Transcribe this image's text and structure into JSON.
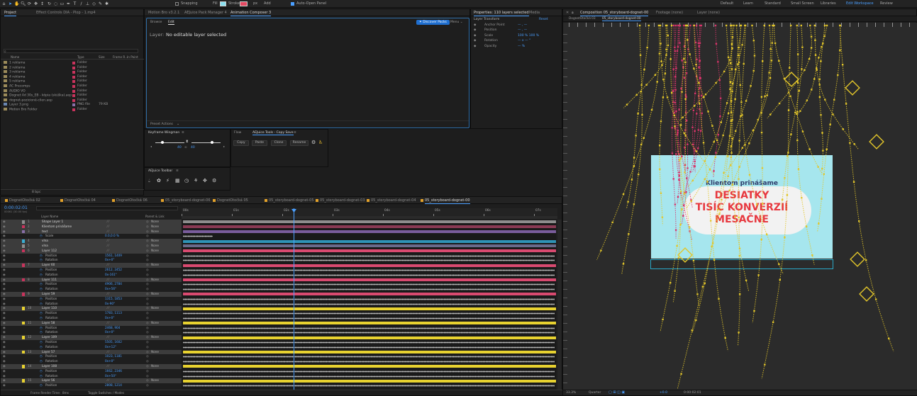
{
  "toolbar": {
    "snapping": "Snapping",
    "fill": "Fill",
    "stroke": "Stroke",
    "stroke_px": "px",
    "add": "Add",
    "auto_open_panel": "Auto-Open Panel",
    "workspaces": [
      "Default",
      "Learn",
      "Standard",
      "Small Screen",
      "Libraries",
      "Edit Workspace",
      "Review"
    ],
    "active_workspace": 5
  },
  "project": {
    "tabs": [
      "Project",
      "Effect Controls DIA - Plop - 1.mp4"
    ],
    "search_placeholder": "",
    "headers": [
      "Name",
      "Type",
      "Size",
      "Frame R...",
      "In Point"
    ],
    "items": [
      {
        "name": "1 reklama",
        "type": "Folder",
        "size": "",
        "fr": "",
        "color": "#c9335c"
      },
      {
        "name": "2 reklama",
        "type": "Folder",
        "size": "",
        "fr": "",
        "color": "#c9335c"
      },
      {
        "name": "3 reklama",
        "type": "Folder",
        "size": "",
        "fr": "",
        "color": "#c9335c"
      },
      {
        "name": "4 reklama",
        "type": "Folder",
        "size": "",
        "fr": "",
        "color": "#c9335c"
      },
      {
        "name": "5 reklama",
        "type": "Folder",
        "size": "",
        "fr": "",
        "color": "#c9335c"
      },
      {
        "name": "AC Precomps",
        "type": "Folder",
        "size": "",
        "fr": "",
        "color": "#c9335c"
      },
      {
        "name": "AUDIO VO",
        "type": "Folder",
        "size": "",
        "fr": "",
        "color": "#c9335c"
      },
      {
        "name": "Dognet Ad 30s_EB - kópia (skúška).aep",
        "type": "Folder",
        "size": "",
        "fr": "",
        "color": "#c9335c"
      },
      {
        "name": "dognet-pozicioné-clien.aep",
        "type": "Folder",
        "size": "",
        "fr": "",
        "color": "#c9335c"
      },
      {
        "name": "Layer 3.png",
        "type": "PNG file",
        "size": "79 KB",
        "fr": "",
        "color": "#8a6fa8"
      },
      {
        "name": "Motion Bro Folder",
        "type": "Folder",
        "size": "",
        "fr": "",
        "color": "#c9335c"
      }
    ],
    "footer": "8 bpc"
  },
  "motion_bro": {
    "tabs": [
      "Motion Bro v3.2.1",
      "AEJuice Pack Manager 4",
      "Animation Composer 3"
    ],
    "active_tab": 2,
    "subtabs": [
      "Browse",
      "Edit"
    ],
    "active_subtab": 1,
    "discover": "Discover Packs",
    "menu": "Menu",
    "layer_label": "Layer:",
    "layer_value": "No editable layer selected",
    "preset_actions": "Preset Actions"
  },
  "properties": {
    "tabs": [
      "Properties: 110 layers selected",
      "Media"
    ],
    "section": "Layer Transform",
    "reset": "Reset",
    "rows": [
      {
        "label": "Anchor Point",
        "value": "—  ,  —"
      },
      {
        "label": "Position",
        "value": "—  ,  —"
      },
      {
        "label": "Scale",
        "value": "100 %   100 %"
      },
      {
        "label": "Rotation",
        "value": "— x  — °"
      },
      {
        "label": "Opacity",
        "value": "— %"
      }
    ]
  },
  "keyframe_wingman": {
    "title": "Keyframe Wingman",
    "in_value": "40",
    "out_value": "40"
  },
  "aejuice": {
    "tabs": [
      "Flow",
      "AEJuice Tools - Copy Save"
    ],
    "active_tab": 1,
    "buttons": [
      "Copy",
      "Paste",
      "Clone",
      "Rename"
    ]
  },
  "aejuice_toolbar": {
    "title": "AEJuice Toolbar"
  },
  "timeline": {
    "timecode": "0:00:02:01",
    "fps": "00061 (30.00 fps)",
    "tabs": [
      "DognetOtočká 02",
      "DognetOtočká 04",
      "DognetOtočká 06",
      "05_storyboard-dognet-06",
      "DognetOtočká 05",
      "05_storyboard-dognet-05",
      "05_storyboard-dognet-03",
      "05_storyboard-dognet-04",
      "05_storyboard-dognet-00"
    ],
    "active_tab": 8,
    "col_headers": [
      "Layer Name",
      "Parent & Link"
    ],
    "ruler": [
      "00s",
      "01s",
      "02s",
      "03s",
      "04s",
      "05s",
      "06s",
      "07s"
    ],
    "footer": {
      "render_label": "Frame Render Time:",
      "render_value": "8ms",
      "toggle": "Toggle Switches / Modes"
    },
    "rows": [
      {
        "n": "1",
        "name": "Shape Layer 1",
        "parent": "None",
        "color": "#8d8d8d",
        "kind": "layer",
        "sel": true,
        "bar": "#8d8d8d"
      },
      {
        "n": "2",
        "name": "Klientom prinášame",
        "parent": "None",
        "color": "#c9335c",
        "kind": "layer",
        "sel": true,
        "bar": "#8a3a54"
      },
      {
        "n": "3",
        "name": "text",
        "parent": "None",
        "color": "#8a6fa8",
        "kind": "layer",
        "sel": true,
        "bar": "#7a5d9c"
      },
      {
        "n": "",
        "name": "Scale",
        "parent": "",
        "color": "",
        "kind": "prop",
        "val": "0.0,0.0 %",
        "kf": [
          0,
          0.08
        ]
      },
      {
        "n": "4",
        "name": "vlna",
        "parent": "None",
        "color": "#3aaed3",
        "kind": "layer",
        "sel": true,
        "bar": "#2f93b6"
      },
      {
        "n": "5",
        "name": "vlna",
        "parent": "None",
        "color": "#8d8d8d",
        "kind": "layer",
        "sel": true,
        "bar": "#6a6a8a"
      },
      {
        "n": "6",
        "name": "Layer 112",
        "parent": "None",
        "color": "#c9335c",
        "kind": "layer",
        "sel": true,
        "bar": "#d94a70"
      },
      {
        "n": "",
        "name": "Position",
        "parent": "",
        "color": "",
        "kind": "prop",
        "val": "1561, 1409",
        "kf": [
          0,
          1
        ]
      },
      {
        "n": "",
        "name": "Rotation",
        "parent": "",
        "color": "",
        "kind": "prop",
        "val": "0x+0°",
        "kf": [
          0,
          1
        ]
      },
      {
        "n": "7",
        "name": "Layer 60",
        "parent": "None",
        "color": "#c9335c",
        "kind": "layer",
        "sel": true,
        "bar": "#d94a70"
      },
      {
        "n": "",
        "name": "Position",
        "parent": "",
        "color": "",
        "kind": "prop",
        "val": "2612, 2452",
        "kf": [
          0,
          1
        ]
      },
      {
        "n": "",
        "name": "Rotation",
        "parent": "",
        "color": "",
        "kind": "prop",
        "val": "0x-161°",
        "kf": [
          0,
          1
        ]
      },
      {
        "n": "8",
        "name": "Layer 111",
        "parent": "None",
        "color": "#c9335c",
        "kind": "layer",
        "sel": true,
        "bar": "#d94a70"
      },
      {
        "n": "",
        "name": "Position",
        "parent": "",
        "color": "",
        "kind": "prop",
        "val": "4906, 2784",
        "kf": [
          0,
          1
        ]
      },
      {
        "n": "",
        "name": "Rotation",
        "parent": "",
        "color": "",
        "kind": "prop",
        "val": "0x+56°",
        "kf": [
          0,
          1
        ]
      },
      {
        "n": "9",
        "name": "Layer 59",
        "parent": "None",
        "color": "#c9335c",
        "kind": "layer",
        "sel": true,
        "bar": "#d94a70"
      },
      {
        "n": "",
        "name": "Position",
        "parent": "",
        "color": "",
        "kind": "prop",
        "val": "1315, 1853",
        "kf": [
          0,
          1
        ]
      },
      {
        "n": "",
        "name": "Rotation",
        "parent": "",
        "color": "",
        "kind": "prop",
        "val": "0x-90°",
        "kf": [
          0,
          1
        ]
      },
      {
        "n": "10",
        "name": "Layer 110",
        "parent": "None",
        "color": "#e8d230",
        "kind": "layer",
        "sel": true,
        "bar": "#e8d230"
      },
      {
        "n": "",
        "name": "Position",
        "parent": "",
        "color": "",
        "kind": "prop",
        "val": "1783, 1113",
        "kf": [
          0,
          1
        ]
      },
      {
        "n": "",
        "name": "Rotation",
        "parent": "",
        "color": "",
        "kind": "prop",
        "val": "0x+0°",
        "kf": [
          0,
          1
        ]
      },
      {
        "n": "11",
        "name": "Layer 58",
        "parent": "None",
        "color": "#e8d230",
        "kind": "layer",
        "sel": true,
        "bar": "#e8d230"
      },
      {
        "n": "",
        "name": "Position",
        "parent": "",
        "color": "",
        "kind": "prop",
        "val": "2468, 904",
        "kf": [
          0,
          1
        ]
      },
      {
        "n": "",
        "name": "Rotation",
        "parent": "",
        "color": "",
        "kind": "prop",
        "val": "0x+0°",
        "kf": [
          0,
          1
        ]
      },
      {
        "n": "12",
        "name": "Layer 109",
        "parent": "None",
        "color": "#e8d230",
        "kind": "layer",
        "sel": true,
        "bar": "#e8d230"
      },
      {
        "n": "",
        "name": "Position",
        "parent": "",
        "color": "",
        "kind": "prop",
        "val": "5505, 1602",
        "kf": [
          0,
          1
        ]
      },
      {
        "n": "",
        "name": "Rotation",
        "parent": "",
        "color": "",
        "kind": "prop",
        "val": "0x+12°",
        "kf": [
          0,
          1
        ]
      },
      {
        "n": "13",
        "name": "Layer 57",
        "parent": "None",
        "color": "#e8d230",
        "kind": "layer",
        "sel": true,
        "bar": "#e8d230"
      },
      {
        "n": "",
        "name": "Position",
        "parent": "",
        "color": "",
        "kind": "prop",
        "val": "1023, 1181",
        "kf": [
          0,
          1
        ]
      },
      {
        "n": "",
        "name": "Rotation",
        "parent": "",
        "color": "",
        "kind": "prop",
        "val": "0x+0°",
        "kf": [
          0,
          1
        ]
      },
      {
        "n": "14",
        "name": "Layer 108",
        "parent": "None",
        "color": "#e8d230",
        "kind": "layer",
        "sel": true,
        "bar": "#e8d230"
      },
      {
        "n": "",
        "name": "Position",
        "parent": "",
        "color": "",
        "kind": "prop",
        "val": "1662, 2346",
        "kf": [
          0,
          1
        ]
      },
      {
        "n": "",
        "name": "Rotation",
        "parent": "",
        "color": "",
        "kind": "prop",
        "val": "0x+50°",
        "kf": [
          0,
          1
        ]
      },
      {
        "n": "15",
        "name": "Layer 56",
        "parent": "None",
        "color": "#e8d230",
        "kind": "layer",
        "sel": true,
        "bar": "#e8d230"
      },
      {
        "n": "",
        "name": "Position",
        "parent": "",
        "color": "",
        "kind": "prop",
        "val": "2808, 1214",
        "kf": [
          0,
          1
        ]
      }
    ]
  },
  "composition": {
    "tab": "Composition 05_storyboard-dognet-00",
    "other_tabs": [
      "Footage (none)",
      "Layer (none)"
    ],
    "sub_tabs": [
      "DognetOtočká 03",
      "05_storyboard-dognet-00"
    ],
    "banner": {
      "line1": "Klientom prinášame",
      "line2": "DESIATKY",
      "line3": "TISÍC KONVERZIÍ",
      "line4": "MESAČNE"
    },
    "footer": {
      "zoom": "33.3%",
      "quality": "Quarter",
      "exposure": "+0.0",
      "timecode": "0:00:02:01"
    }
  },
  "colors": {
    "accent": "#4a9fff",
    "pink": "#d94a70",
    "yellow": "#e8d230",
    "cyan": "#3aaed3",
    "banner_bg": "#a6e6ee",
    "banner_text": "#e7383f"
  }
}
